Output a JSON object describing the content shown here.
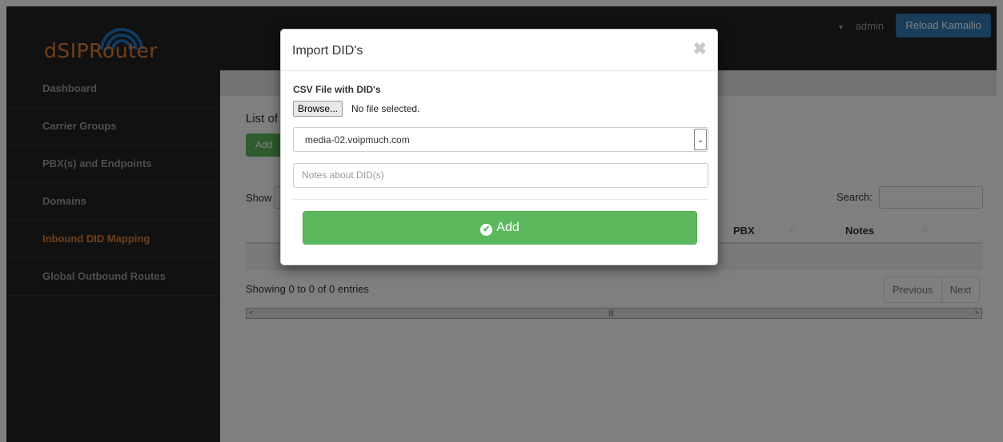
{
  "app": {
    "brand": "dSIPRouter",
    "accent_color": "#e0813b",
    "user": "admin",
    "reload_label": "Reload Kamailio"
  },
  "sidebar": {
    "items": [
      {
        "label": "Dashboard"
      },
      {
        "label": "Carrier Groups"
      },
      {
        "label": "PBX(s) and Endpoints"
      },
      {
        "label": "Domains"
      },
      {
        "label": "Inbound DID Mapping",
        "active": true
      },
      {
        "label": "Global Outbound Routes"
      }
    ]
  },
  "main": {
    "heading": "List of",
    "add_label": "Add",
    "show_label": "Show",
    "search_label": "Search:",
    "columns": [
      {
        "label": "PBX"
      },
      {
        "label": "Notes"
      }
    ],
    "showing_text": "Showing 0 to 0 of 0 entries",
    "pager": {
      "previous": "Previous",
      "next": "Next"
    }
  },
  "modal": {
    "title": "Import DID's",
    "file_label": "CSV File with DID's",
    "browse_label": "Browse...",
    "file_status": "No file selected.",
    "media_select_value": "media-02.voipmuch.com",
    "notes_placeholder": "Notes about DID(s)",
    "submit_label": "Add"
  }
}
